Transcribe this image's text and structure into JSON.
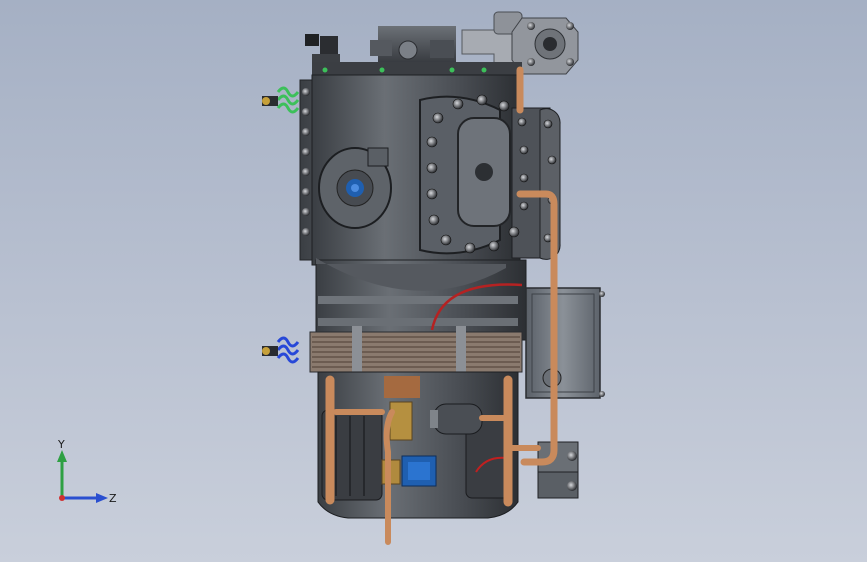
{
  "viewport": {
    "background_top": "#a5b0c4",
    "background_bottom": "#c9cfdb"
  },
  "model": {
    "body_color": "#4f5358",
    "body_dark": "#2e3136",
    "copper_color": "#c98a5c",
    "blue_part_color": "#1f5fb0",
    "green_spring_color": "#3cc05a"
  },
  "triad": {
    "y_label": "Y",
    "z_label": "Z",
    "y_axis_color": "#2ea043",
    "z_axis_color": "#2a4fd0",
    "origin_color": "#d03030"
  }
}
